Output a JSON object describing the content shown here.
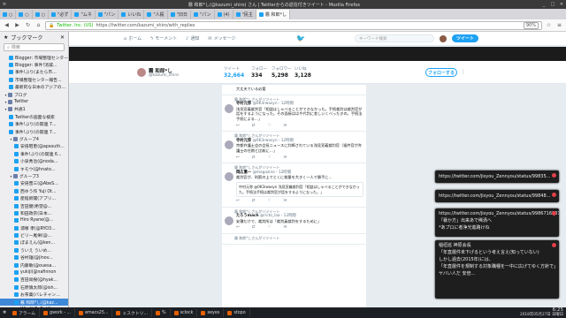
{
  "window": {
    "title": "霧 和郎*し(@kazumi_shiro) さん | Twitterからの返信付きツイート - Mozilla Firefox"
  },
  "tabs": [
    {
      "label": "○"
    },
    {
      "label": "○"
    },
    {
      "label": "○"
    },
    {
      "label": "\"必ず"
    },
    {
      "label": "\"ムネ"
    },
    {
      "label": "\"パン"
    },
    {
      "label": "いいね"
    },
    {
      "label": "\"人殺"
    },
    {
      "label": "\"旧日"
    },
    {
      "label": "\"パン"
    },
    {
      "label": "(4)"
    },
    {
      "label": "\"民主"
    },
    {
      "label": "霧 和郎*し"
    }
  ],
  "url": {
    "org": "Twitter, Inc. (US)",
    "address": "https://twitter.com/kazumi_shiro/with_replies",
    "zoom": "90%"
  },
  "sidebar": {
    "title": "ブックマーク",
    "search_placeholder": "検索",
    "items": [
      {
        "label": "Blogger: 市場整理センター",
        "indent": 1,
        "type": "bm"
      },
      {
        "label": "Blogger: 事件!消滅...",
        "indent": 1,
        "type": "bm"
      },
      {
        "label": "事件!ぶり(またら市...",
        "indent": 1,
        "type": "bm"
      },
      {
        "label": "市場整理センター報告...",
        "indent": 1,
        "type": "bm"
      },
      {
        "label": "最新的な日本のアジアの...",
        "indent": 1,
        "type": "bm"
      },
      {
        "label": "ブログ",
        "indent": 0,
        "type": "folder"
      },
      {
        "label": "Twitter",
        "indent": 0,
        "type": "folder"
      },
      {
        "label": "共通1",
        "indent": 0,
        "type": "folder"
      },
      {
        "label": "Twitterの画面な検索",
        "indent": 1,
        "type": "bm"
      },
      {
        "label": "事件!ぶり(の関連 7...",
        "indent": 1,
        "type": "bm"
      },
      {
        "label": "事件!ぶり(の関連 7...",
        "indent": 1,
        "type": "bm"
      },
      {
        "label": "グループ4",
        "indent": 1,
        "type": "folder"
      },
      {
        "label": "安倍昭恵(@apsouth...",
        "indent": 2,
        "type": "bm"
      },
      {
        "label": "事件!ぶり(の関連 6...",
        "indent": 2,
        "type": "bm"
      },
      {
        "label": "小泉秀治(@noda...",
        "indent": 2,
        "type": "bm"
      },
      {
        "label": "キモウ(@hnato...",
        "indent": 2,
        "type": "bm"
      },
      {
        "label": "グループ3",
        "indent": 1,
        "type": "folder"
      },
      {
        "label": "安倍晋三(@AbeS...",
        "indent": 2,
        "type": "bm"
      },
      {
        "label": "西ゆう作 Yuji Ot...",
        "indent": 2,
        "type": "bm"
      },
      {
        "label": "産経新聞(アプリ...",
        "indent": 2,
        "type": "bm"
      },
      {
        "label": "吉田健(希望@...",
        "indent": 2,
        "type": "bm"
      },
      {
        "label": "和田政宗(日本...",
        "indent": 2,
        "type": "bm"
      },
      {
        "label": "Hiro Ryane(@...",
        "indent": 2,
        "type": "bm"
      },
      {
        "label": "浦塚 孝(@RYO3...",
        "indent": 2,
        "type": "bm"
      },
      {
        "label": "ビリー尾栄(@...",
        "indent": 2,
        "type": "bm"
      },
      {
        "label": "ぽまえん(@ken...",
        "indent": 2,
        "type": "bm"
      },
      {
        "label": "ういえ ういめ...",
        "indent": 2,
        "type": "bm"
      },
      {
        "label": "谷村雄(@jlnov...",
        "indent": 2,
        "type": "bm"
      },
      {
        "label": "内藤敏(@ouesa...",
        "indent": 2,
        "type": "bm"
      },
      {
        "label": "yukiji(@nafinnon",
        "indent": 2,
        "type": "bm"
      },
      {
        "label": "百田尚樹(@hyak...",
        "indent": 2,
        "type": "bm"
      },
      {
        "label": "石原慎太郎(@ish...",
        "indent": 2,
        "type": "bm"
      },
      {
        "label": "お茶菓(バレチャン...",
        "indent": 2,
        "type": "bm"
      },
      {
        "label": "霧 和郎*し(@kaz...",
        "indent": 2,
        "type": "bm",
        "selected": true
      },
      {
        "label": "WhoYsBeRe(@...",
        "indent": 2,
        "type": "bm"
      }
    ]
  },
  "twitter": {
    "nav": {
      "home": "ホーム",
      "moments": "モーメント",
      "notifications": "通知",
      "messages": "メッセージ",
      "search_placeholder": "キーワード検索",
      "tweet_button": "ツイート"
    },
    "profile": {
      "name": "霧 和郎*し",
      "handle": "@kazumi_shiro",
      "stats": [
        {
          "label": "ツイート",
          "value": "32,664"
        },
        {
          "label": "フォロー",
          "value": "334"
        },
        {
          "label": "フォロワー",
          "value": "5,298"
        },
        {
          "label": "いいね",
          "value": "3,128"
        }
      ],
      "follow_button": "フォローする"
    },
    "tweets": [
      {
        "context": "",
        "name": "",
        "handle": "",
        "time": "",
        "body": "大丈夫でいる必要",
        "quote": "",
        "replies": "",
        "retweets": "",
        "likes": ""
      },
      {
        "context": "霧 和郎*しさんがリツイート",
        "name": "寺村元弥",
        "handle": "@0K3rwasyn",
        "time": "12時間",
        "body": "浅見宣義裁判官「相談はしゃべることができなかった。手続裁判は裁判官が話をするようになった。その面接ははや代判に差しいくべったきの。手続法手続による…」",
        "quote": "",
        "replies": "",
        "retweets": "",
        "likes": ""
      },
      {
        "context": "霧 和郎*しさんがリツイート",
        "name": "寺村元弥",
        "handle": "@0K3rwasyn",
        "time": "12時間",
        "body": "京都弁護士会の会長ニュースに判断されている浅見宣義裁判官（福井官が弁護士の任期と比較に…」",
        "quote": "",
        "replies": "",
        "retweets": "",
        "likes": ""
      },
      {
        "context": "霧 和郎*しさんがリツイート",
        "name": "岡広重一",
        "handle": "@magazine",
        "time": "12時間",
        "body": "裁判官が、刑罰の上でとくに裁量を大きく一人で勝手に…",
        "quote": "中村元弥 @0K3rwasyn 浅見宣義裁判官「相談はしゃべることができなかった。手続法手続は裁判官が話をするようになった。」",
        "replies": "",
        "retweets": "",
        "likes": ""
      },
      {
        "context": "霧 和郎*しさんがリツイート",
        "name": "たろうmach",
        "handle": "@ricto_laa",
        "time": "12時間",
        "body": "安積だけで、裁判所は「裁判員裁判をするために」",
        "quote": "",
        "replies": "",
        "retweets": "",
        "likes": ""
      },
      {
        "context": "霧 和郎*しさんがリツイート",
        "name": "",
        "handle": "",
        "time": "",
        "body": "",
        "quote": "",
        "replies": "",
        "retweets": "",
        "likes": ""
      }
    ]
  },
  "notes": [
    {
      "lines": [
        "https://twitter.com/jisyou_Zennyou/status/99835..."
      ]
    },
    {
      "lines": [
        "https://twitter.com/jisyou_Zennyou/status/99848..."
      ]
    },
    {
      "lines": [
        "https://twitter.com/jisyou_Zennyou/status/9986716301:",
        "「暴か方」出来あで稀渦へ",
        "*あプロに者浄光進路けね"
      ]
    },
    {
      "lines": [
        "稲垣巡 神原会長",
        "「年直層件未下げるという考え言え(知っていない)",
        "",
        "しかし過去(2015年)には、",
        "「年直層件を規制する対象職種を一中に広げてゆく方針で」",
        "",
        "ヤバい人だ 安倍..."
      ]
    }
  ],
  "taskbar": {
    "items": [
      {
        "label": "アラーム"
      },
      {
        "label": "gwork - ..."
      },
      {
        "label": "emacs25..."
      },
      {
        "label": "ェスクトリ..."
      },
      {
        "label": "% "
      },
      {
        "label": "sclock"
      },
      {
        "label": "xeyes"
      },
      {
        "label": "stopo"
      }
    ],
    "clock_time": "6:25",
    "clock_date": "2018年05月27日 日曜日"
  }
}
